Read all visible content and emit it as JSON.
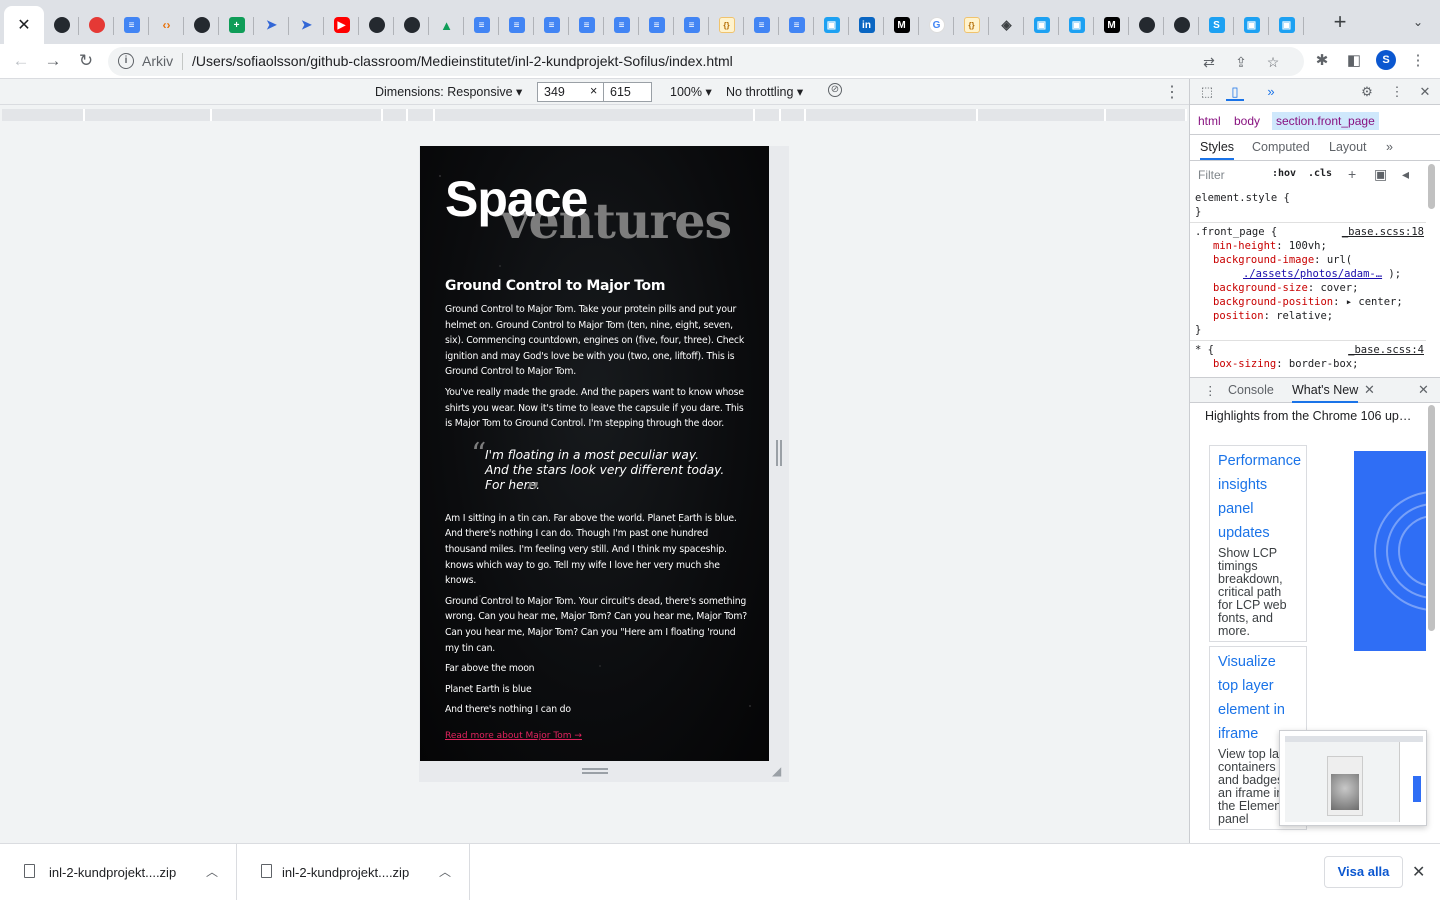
{
  "browser": {
    "tabs": [
      {
        "icon": "close-icon",
        "label": "✕",
        "active": true
      },
      {
        "icon": "github-icon"
      },
      {
        "icon": "map-pin-icon"
      },
      {
        "icon": "google-docs-icon"
      },
      {
        "icon": "code-icon"
      },
      {
        "icon": "github-icon"
      },
      {
        "icon": "google-sheets-icon"
      },
      {
        "icon": "vscode-icon"
      },
      {
        "icon": "vscode-icon"
      },
      {
        "icon": "youtube-icon"
      },
      {
        "icon": "github-icon"
      },
      {
        "icon": "github-icon"
      },
      {
        "icon": "google-drive-icon"
      },
      {
        "icon": "google-docs-icon"
      },
      {
        "icon": "google-docs-icon"
      },
      {
        "icon": "google-docs-icon"
      },
      {
        "icon": "google-docs-icon"
      },
      {
        "icon": "google-docs-icon"
      },
      {
        "icon": "google-docs-icon"
      },
      {
        "icon": "google-docs-icon"
      },
      {
        "icon": "json-icon"
      },
      {
        "icon": "google-docs-icon"
      },
      {
        "icon": "google-docs-icon"
      },
      {
        "icon": "app-icon"
      },
      {
        "icon": "linkedin-icon"
      },
      {
        "icon": "medium-icon"
      },
      {
        "icon": "google-icon"
      },
      {
        "icon": "json-icon"
      },
      {
        "icon": "eraser-icon"
      },
      {
        "icon": "app-icon"
      },
      {
        "icon": "app-icon"
      },
      {
        "icon": "medium-icon"
      },
      {
        "icon": "github-icon"
      },
      {
        "icon": "github-icon"
      },
      {
        "icon": "skype-icon"
      },
      {
        "icon": "app-icon"
      },
      {
        "icon": "app-icon"
      }
    ],
    "new_tab_label": "+",
    "omnibox": {
      "label": "Arkiv",
      "url": "/Users/sofiaolsson/github-classroom/Medieinstitutet/inl-2-kundprojekt-Sofilus/index.html"
    },
    "avatar_letter": "S"
  },
  "device_toolbar": {
    "dimensions_label": "Dimensions: Responsive ▾",
    "width": "349",
    "height": "615",
    "times": "×",
    "zoom": "100% ▾",
    "throttling": "No throttling ▾"
  },
  "page": {
    "hero_line1": "Space",
    "hero_line2": "ventures",
    "heading": "Ground Control to Major Tom",
    "paragraphs": [
      "Ground Control to Major Tom. Take your protein pills and put your helmet on. Ground Control to Major Tom (ten, nine, eight, seven, six). Commencing countdown, engines on (five, four, three). Check ignition and may God's love be with you (two, one, liftoff). This is Ground Control to Major Tom.",
      "You've really made the grade. And the papers want to know whose shirts you wear. Now it's time to leave the capsule if you dare. This is Major Tom to Ground Control. I'm stepping through the door."
    ],
    "quote_lines": [
      "I'm floating in a most peculiar way.",
      "And the stars look very different today.",
      "For here."
    ],
    "paragraphs_after": [
      "Am I sitting in a tin can. Far above the world. Planet Earth is blue. And there's nothing I can do. Though I'm past one hundred thousand miles. I'm feeling very still. And I think my spaceship. knows which way to go. Tell my wife I love her very much she knows.",
      "Ground Control to Major Tom. Your circuit's dead, there's something wrong. Can you hear me, Major Tom? Can you hear me, Major Tom? Can you hear me, Major Tom? Can you \"Here am I floating 'round my tin can.",
      "Far above the moon",
      "Planet Earth is blue",
      "And there's nothing I can do"
    ],
    "read_more": "Read more about Major Tom  →"
  },
  "devtools": {
    "breadcrumbs": [
      "html",
      "body",
      "section.front_page"
    ],
    "subtabs": [
      "Styles",
      "Computed",
      "Layout"
    ],
    "filter_placeholder": "Filter",
    "hov": ":hov",
    "cls": ".cls",
    "rules": {
      "element_style": "element.style {",
      "close": "}",
      "front_page_selector": ".front_page {",
      "front_page_source": "_base.scss:18",
      "decls": [
        {
          "name": "min-height",
          "value": "100vh;"
        },
        {
          "name": "background-image",
          "value": "url("
        },
        {
          "name": "background-size",
          "value": "cover;"
        },
        {
          "name": "background-position",
          "value": "▸ center;"
        },
        {
          "name": "position",
          "value": "relative;"
        }
      ],
      "bg_url": "./assets/photos/adam-…",
      "bg_url_end": ");",
      "star_selector": "* {",
      "star_source": "_base.scss:4",
      "star_decl": {
        "name": "box-sizing",
        "value": "border-box;"
      }
    },
    "drawer_tabs": [
      "Console",
      "What's New"
    ],
    "whats_new_header": "Highlights from the Chrome 106 up…",
    "cards": [
      {
        "title": "Performance insights panel updates",
        "desc": "Show LCP timings breakdown, critical path for LCP web fonts, and more."
      },
      {
        "title": "Visualize top layer element in iframe",
        "desc": "View top layer containers and badges of an iframe in the Elements panel"
      }
    ]
  },
  "downloads": {
    "items": [
      "inl-2-kundprojekt....zip",
      "inl-2-kundprojekt....zip"
    ],
    "show_all": "Visa alla"
  }
}
